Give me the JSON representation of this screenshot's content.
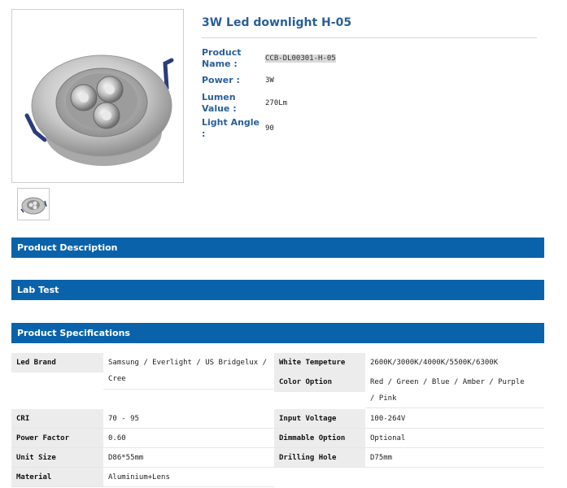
{
  "product": {
    "title": "3W Led downlight H-05",
    "info": [
      {
        "label_line1": "Product",
        "label_line2": "Name :",
        "value": "CCB-DL00301-H-05",
        "highlight": true
      },
      {
        "label_line1": "Power :",
        "label_line2": "",
        "value": "3W",
        "highlight": false
      },
      {
        "label_line1": "Lumen",
        "label_line2": "Value :",
        "value": "270Lm",
        "highlight": false
      },
      {
        "label_line1": "Light Angle :",
        "label_line2": "",
        "value": "90",
        "highlight": false
      }
    ]
  },
  "sections": {
    "description": "Product Description",
    "lab_test": "Lab Test",
    "specifications": "Product Specifications"
  },
  "specs": {
    "led_brand": {
      "label": "Led Brand",
      "value_line1": "Samsung / Everlight / US Bridgelux /",
      "value_line2": "Cree"
    },
    "white_temp": {
      "label": "White Tempeture",
      "value": "2600K/3000K/4000K/5500K/6300K"
    },
    "color_option": {
      "label": "Color Option",
      "value_line1": "Red / Green / Blue / Amber / Purple",
      "value_line2": "/ Pink"
    },
    "cri": {
      "label": "CRI",
      "value": "70 - 95"
    },
    "input_voltage": {
      "label": "Input Voltage",
      "value": "100-264V"
    },
    "power_factor": {
      "label": "Power Factor",
      "value": "0.60"
    },
    "dimmable": {
      "label": "Dimmable Option",
      "value": "Optional"
    },
    "unit_size": {
      "label": "Unit Size",
      "value": "D86*55mm"
    },
    "drilling_hole": {
      "label": "Drilling Hole",
      "value": "D75mm"
    },
    "material": {
      "label": "Material",
      "value": "Aluminium+Lens"
    }
  },
  "colors": {
    "accent": "#0a63aa",
    "title": "#2a5f98",
    "label_bg": "#ececec"
  }
}
